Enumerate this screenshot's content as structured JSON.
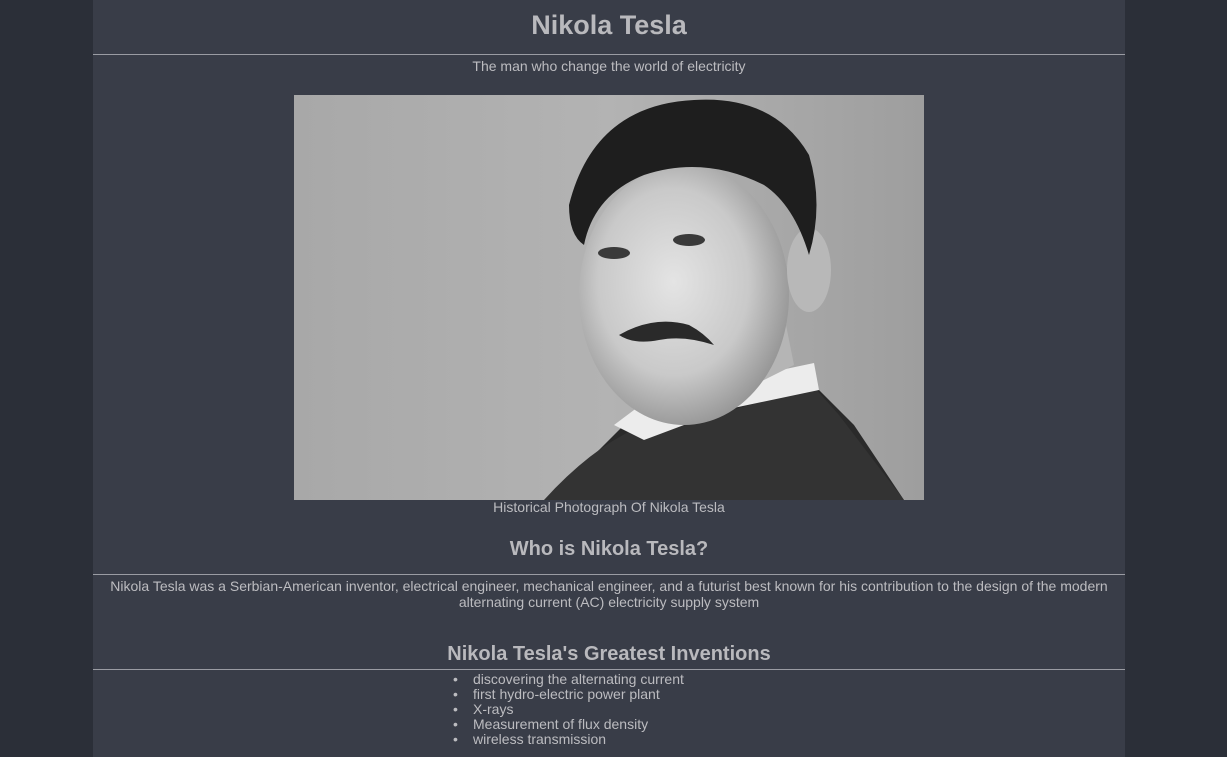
{
  "header": {
    "title": "Nikola Tesla",
    "subtitle": "The man who change the world of electricity"
  },
  "image": {
    "caption": "Historical Photograph Of Nikola Tesla"
  },
  "about": {
    "heading": "Who is Nikola Tesla?",
    "text": "Nikola Tesla was a Serbian-American inventor, electrical engineer, mechanical engineer, and a futurist best known for his contribution to the design of the modern alternating current (AC) electricity supply system"
  },
  "inventions": {
    "heading": "Nikola Tesla's Greatest Inventions",
    "items": [
      "discovering the alternating current",
      "first hydro-electric power plant",
      "X-rays",
      "Measurement of flux density",
      "wireless transmission"
    ]
  },
  "colors": {
    "page_background": "#2b2f38",
    "content_background": "#393d48",
    "text": "#b8b8bd",
    "rule": "#9a9ca3"
  }
}
